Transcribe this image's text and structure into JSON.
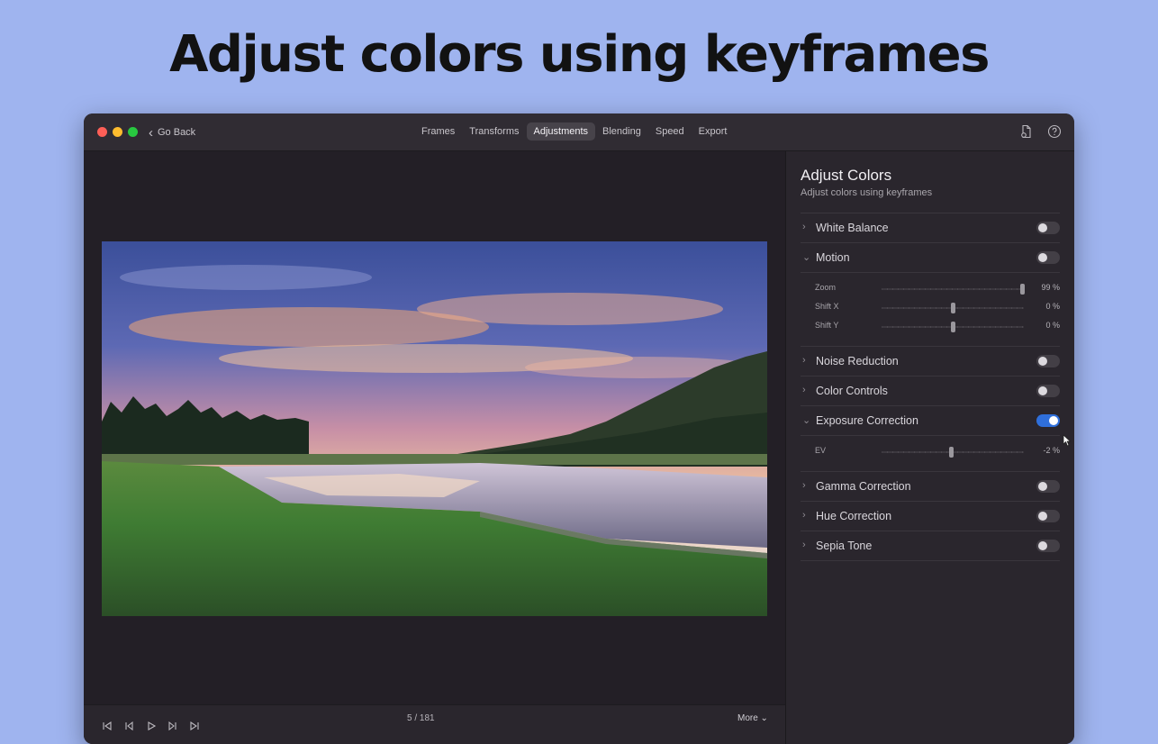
{
  "headline": "Adjust colors using keyframes",
  "titlebar": {
    "go_back": "Go Back",
    "tabs": [
      {
        "label": "Frames"
      },
      {
        "label": "Transforms"
      },
      {
        "label": "Adjustments",
        "active": true
      },
      {
        "label": "Blending"
      },
      {
        "label": "Speed"
      },
      {
        "label": "Export"
      }
    ],
    "icons": [
      "export-document-icon",
      "help-icon"
    ]
  },
  "player": {
    "frame_counter": "5 / 181",
    "more_label": "More ⌄",
    "controls": [
      "skip-to-start-icon",
      "step-back-icon",
      "play-icon",
      "step-forward-icon",
      "skip-to-end-icon"
    ]
  },
  "panel": {
    "title": "Adjust Colors",
    "subtitle": "Adjust colors using keyframes",
    "sections": [
      {
        "label": "White Balance",
        "expanded": false,
        "enabled": false
      },
      {
        "label": "Motion",
        "expanded": true,
        "enabled": false,
        "params": [
          {
            "label": "Zoom",
            "value": "99 %",
            "level": 0.99
          },
          {
            "label": "Shift X",
            "value": "0 %",
            "level": 0.5
          },
          {
            "label": "Shift Y",
            "value": "0 %",
            "level": 0.5
          }
        ]
      },
      {
        "label": "Noise Reduction",
        "expanded": false,
        "enabled": false
      },
      {
        "label": "Color Controls",
        "expanded": false,
        "enabled": false
      },
      {
        "label": "Exposure Correction",
        "expanded": true,
        "enabled": true,
        "params": [
          {
            "label": "EV",
            "value": "-2 %",
            "level": 0.49
          }
        ]
      },
      {
        "label": "Gamma Correction",
        "expanded": false,
        "enabled": false
      },
      {
        "label": "Hue Correction",
        "expanded": false,
        "enabled": false
      },
      {
        "label": "Sepia Tone",
        "expanded": false,
        "enabled": false
      }
    ]
  },
  "colors": {
    "background": "#9fb4ef",
    "window": "#262329",
    "accent": "#2f6fdb"
  }
}
